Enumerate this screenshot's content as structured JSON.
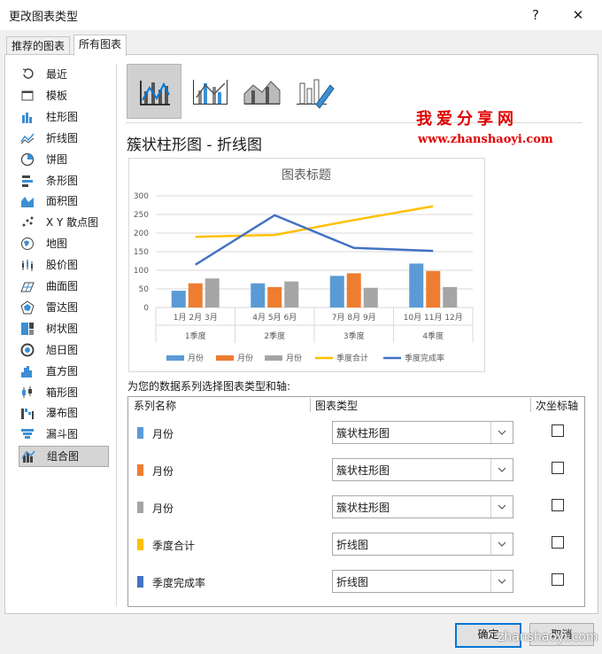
{
  "window": {
    "title": "更改图表类型",
    "help": "?",
    "close": "✕"
  },
  "tabs": [
    "推荐的图表",
    "所有图表"
  ],
  "sidebar": [
    {
      "label": "最近",
      "icon": "recent-icon"
    },
    {
      "label": "模板",
      "icon": "template-icon"
    },
    {
      "label": "柱形图",
      "icon": "column-chart-icon"
    },
    {
      "label": "折线图",
      "icon": "line-chart-icon"
    },
    {
      "label": "饼图",
      "icon": "pie-chart-icon"
    },
    {
      "label": "条形图",
      "icon": "bar-chart-icon"
    },
    {
      "label": "面积图",
      "icon": "area-chart-icon"
    },
    {
      "label": "X Y 散点图",
      "icon": "scatter-chart-icon"
    },
    {
      "label": "地图",
      "icon": "map-chart-icon"
    },
    {
      "label": "股价图",
      "icon": "stock-chart-icon"
    },
    {
      "label": "曲面图",
      "icon": "surface-chart-icon"
    },
    {
      "label": "雷达图",
      "icon": "radar-chart-icon"
    },
    {
      "label": "树状图",
      "icon": "treemap-chart-icon"
    },
    {
      "label": "旭日图",
      "icon": "sunburst-chart-icon"
    },
    {
      "label": "直方图",
      "icon": "histogram-chart-icon"
    },
    {
      "label": "箱形图",
      "icon": "boxplot-chart-icon"
    },
    {
      "label": "瀑布图",
      "icon": "waterfall-chart-icon"
    },
    {
      "label": "漏斗图",
      "icon": "funnel-chart-icon"
    },
    {
      "label": "组合图",
      "icon": "combo-chart-icon",
      "selected": true
    }
  ],
  "combo_heading": "簇状柱形图 - 折线图",
  "watermark": {
    "cn": "我爱分享网",
    "url": "www.zhanshaoyi.com",
    "bottom": "zhanshaoyi.com"
  },
  "chart_data": {
    "type": "bar",
    "title": "图表标题",
    "categories": [
      "1月",
      "2月",
      "3月",
      "4月",
      "5月",
      "6月",
      "7月",
      "8月",
      "9月",
      "10月",
      "11月",
      "12月"
    ],
    "groups": [
      "1季度",
      "2季度",
      "3季度",
      "4季度"
    ],
    "group_labels": [
      "1月 2月 3月",
      "4月 5月 6月",
      "7月 8月 9月",
      "10月 11月 12月"
    ],
    "ylim": [
      0,
      300
    ],
    "yticks": [
      0,
      50,
      100,
      150,
      200,
      250,
      300
    ],
    "grid": true,
    "legend": "bottom",
    "series": [
      {
        "name": "月份",
        "type": "bar",
        "color": "#5b9bd5",
        "values": [
          45,
          65,
          85,
          118
        ]
      },
      {
        "name": "月份",
        "type": "bar",
        "color": "#ed7d31",
        "values": [
          65,
          55,
          92,
          98
        ]
      },
      {
        "name": "月份",
        "type": "bar",
        "color": "#a5a5a5",
        "values": [
          78,
          70,
          53,
          55
        ]
      },
      {
        "name": "季度合计",
        "type": "line",
        "color": "#ffc000",
        "values": [
          190,
          195,
          235,
          272
        ]
      },
      {
        "name": "季度完成率",
        "type": "line",
        "color": "#4472c4",
        "values": [
          115,
          248,
          160,
          152
        ]
      }
    ]
  },
  "series_section": {
    "label": "为您的数据系列选择图表类型和轴:",
    "col_name": "系列名称",
    "col_type": "图表类型",
    "col_axis": "次坐标轴",
    "rows": [
      {
        "name": "月份",
        "color": "#5b9bd5",
        "type": "簇状柱形图",
        "secondary": false
      },
      {
        "name": "月份",
        "color": "#ed7d31",
        "type": "簇状柱形图",
        "secondary": false
      },
      {
        "name": "月份",
        "color": "#a5a5a5",
        "type": "簇状柱形图",
        "secondary": false
      },
      {
        "name": "季度合计",
        "color": "#ffc000",
        "type": "折线图",
        "secondary": false
      },
      {
        "name": "季度完成率",
        "color": "#4472c4",
        "type": "折线图",
        "secondary": false
      }
    ]
  },
  "buttons": {
    "ok": "确定",
    "cancel": "取消"
  }
}
